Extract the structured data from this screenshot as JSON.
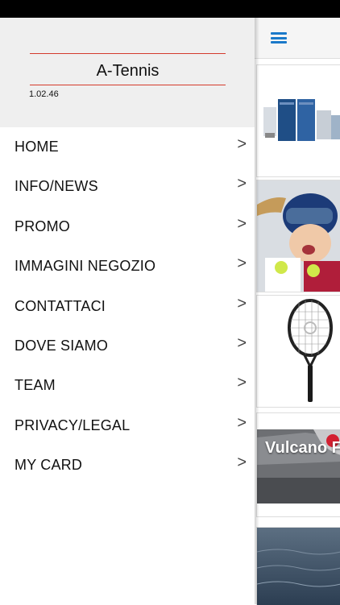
{
  "drawer": {
    "app_title": "A-Tennis",
    "version": "1.02.46",
    "menu": [
      {
        "label": "HOME"
      },
      {
        "label": "INFO/NEWS"
      },
      {
        "label": "PROMO"
      },
      {
        "label": "IMMAGINI NEGOZIO"
      },
      {
        "label": "CONTATTACI"
      },
      {
        "label": "DOVE SIAMO"
      },
      {
        "label": "TEAM"
      },
      {
        "label": "PRIVACY/LEGAL"
      },
      {
        "label": "MY CARD"
      }
    ],
    "chevron": ">"
  },
  "content": {
    "icons": {
      "menu": "hamburger-icon"
    },
    "cards": [
      {
        "caption": ""
      },
      {
        "caption": ""
      },
      {
        "caption": ""
      },
      {
        "caption": "Vulcano F"
      },
      {
        "caption": ""
      }
    ]
  },
  "colors": {
    "accent_red": "#d43a2c",
    "accent_blue": "#1b79c9",
    "header_bg": "#efefef"
  }
}
